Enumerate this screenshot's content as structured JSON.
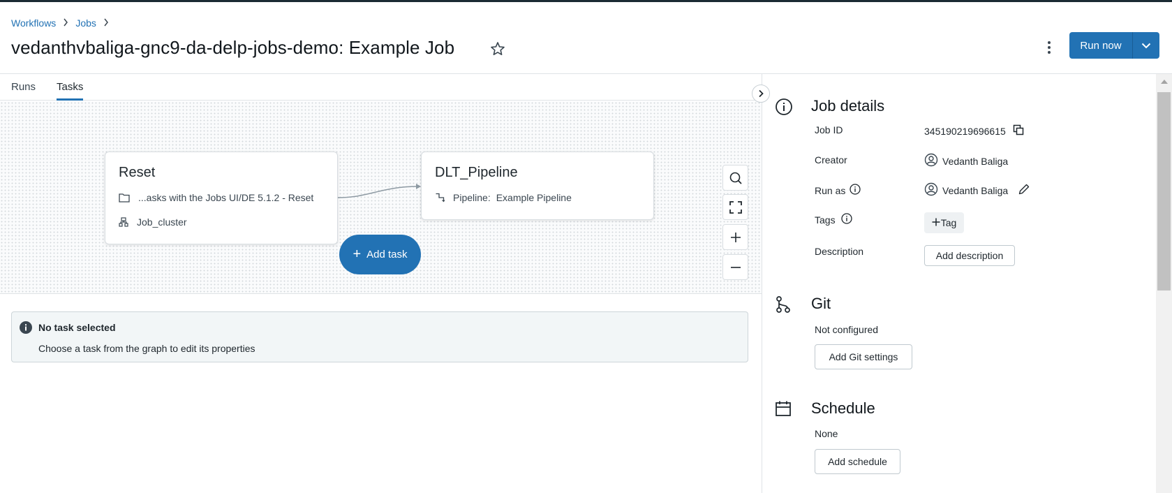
{
  "breadcrumb": {
    "items": [
      "Workflows",
      "Jobs"
    ],
    "separator": "›"
  },
  "page": {
    "title": "vedanthvbaliga-gnc9-da-delp-jobs-demo: Example Job"
  },
  "actions": {
    "run_now": "Run now"
  },
  "tabs": [
    {
      "label": "Runs",
      "active": false
    },
    {
      "label": "Tasks",
      "active": true
    }
  ],
  "graph": {
    "tasks": [
      {
        "name": "Reset",
        "path": "...asks with the Jobs UI/DE 5.1.2 - Reset",
        "cluster": "Job_cluster"
      },
      {
        "name": "DLT_Pipeline",
        "pipeline_label": "Pipeline:",
        "pipeline_name": "Example Pipeline"
      }
    ],
    "add_task": "Add task"
  },
  "info": {
    "title": "No task selected",
    "body": "Choose a task from the graph to edit its properties"
  },
  "job_details": {
    "title": "Job details",
    "job_id_label": "Job ID",
    "job_id": "345190219696615",
    "creator_label": "Creator",
    "creator": "Vedanth Baliga",
    "run_as_label": "Run as",
    "run_as": "Vedanth Baliga",
    "tags_label": "Tags",
    "tag_button": "Tag",
    "description_label": "Description",
    "description_button": "Add description"
  },
  "git": {
    "title": "Git",
    "status": "Not configured",
    "button": "Add Git settings"
  },
  "schedule": {
    "title": "Schedule",
    "status": "None",
    "button": "Add schedule"
  },
  "colors": {
    "primary": "#2272b4",
    "topbar": "#1b2b33",
    "canvas_bg": "#fafbfc",
    "info_bg": "#f2f6f7"
  }
}
